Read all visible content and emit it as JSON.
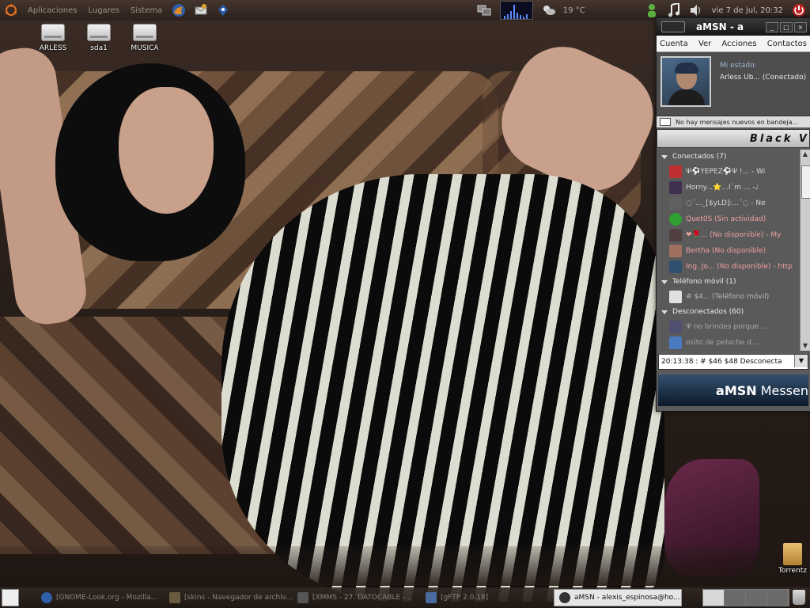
{
  "top_panel": {
    "menus": [
      "Aplicaciones",
      "Lugares",
      "Sistema"
    ],
    "weather": "19 °C",
    "clock": "vie  7 de jul, 20:32"
  },
  "desktop_icons": [
    "ARLESS",
    "sda1",
    "MUSICA"
  ],
  "amsn": {
    "title": "aMSN - a",
    "menu": [
      "Cuenta",
      "Ver",
      "Acciones",
      "Contactos"
    ],
    "status_label": "Mi estado:",
    "status_value": "Arless Ub... (Conectado)",
    "mail_notice": "No hay mensajes nuevos en bandeja...",
    "skin_banner": "Black V",
    "groups": {
      "online": "Conectados (7)",
      "mobile": "Teléfono móvil (1)",
      "offline": "Desconectados (60)"
    },
    "contacts_online": [
      "Ψ⚽YEPEZ⚽Ψ   !... - Wi",
      "Horny...⭐...I`m ... -♩",
      "◌´..._[$yLD]:...´◌  - Ne",
      "Quet0S  (Sin actividad)",
      "❤🌹... (No disponible) - My",
      "Bertha  (No disponible)",
      "Ing. Jo...  (No disponible) - http"
    ],
    "contacts_mobile": [
      "# $4...  (Teléfono móvil)"
    ],
    "contacts_offline": [
      "Ψ no brindes porque ...",
      "osito de peluche d..."
    ],
    "status_combo": "20:13:38 : # $46  $48 Desconecta",
    "brand_main": "aMSN",
    "brand_sub": "Messen"
  },
  "torrentz_label": "Torrentz",
  "taskbar": [
    "[GNOME-Look.org - Mozilla...",
    "[skins - Navegador de archiv...",
    "[XMMS - 27. DATOCABLE -...",
    "[gFTP 2.0.18]",
    "aMSN - alexis_espinosa@ho..."
  ],
  "colors": {
    "amsn_frame": "#5c5c5c",
    "away_contact": "#f0a0a0",
    "brand_bg": "#34506e"
  }
}
